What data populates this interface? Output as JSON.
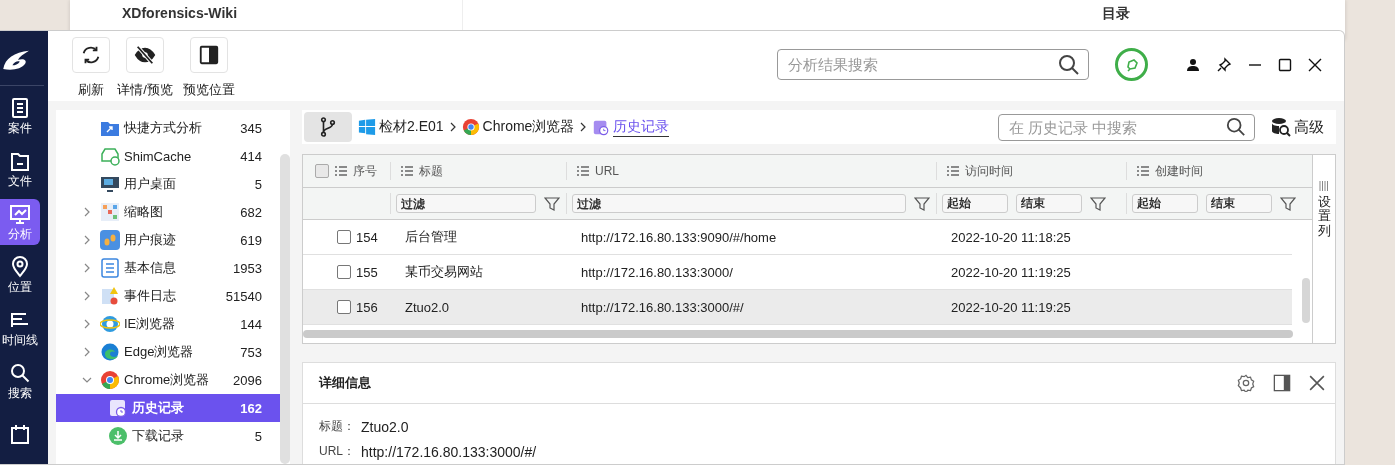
{
  "background_window": {
    "site_title": "XDforensics-Wiki",
    "toc_title": "目录"
  },
  "nav_rail": {
    "items": [
      {
        "label": "案件",
        "kind": "case",
        "selected": false
      },
      {
        "label": "文件",
        "kind": "file",
        "selected": false
      },
      {
        "label": "分析",
        "kind": "analysis",
        "selected": true
      },
      {
        "label": "位置",
        "kind": "location",
        "selected": false
      },
      {
        "label": "时间线",
        "kind": "timeline",
        "selected": false
      },
      {
        "label": "搜索",
        "kind": "search",
        "selected": false
      },
      {
        "kind": "calendar",
        "selected": false
      }
    ]
  },
  "toolbar": {
    "buttons": [
      {
        "label": "刷新",
        "kind": "refresh"
      },
      {
        "label": "详情/预览",
        "kind": "hide"
      },
      {
        "label": "预览位置",
        "kind": "panel"
      }
    ],
    "search": {
      "placeholder": "分析结果搜索"
    }
  },
  "tree": {
    "items": [
      {
        "label": "快捷方式分析",
        "count": "345",
        "kind": "shortcut",
        "selected": false
      },
      {
        "label": "ShimCache",
        "count": "414",
        "kind": "shimcache",
        "selected": false
      },
      {
        "label": "用户桌面",
        "count": "5",
        "kind": "desktop",
        "selected": false
      },
      {
        "label": "缩略图",
        "count": "682",
        "kind": "thumbnail",
        "expanded": false,
        "selected": false
      },
      {
        "label": "用户痕迹",
        "count": "619",
        "kind": "trace",
        "expanded": false,
        "selected": false
      },
      {
        "label": "基本信息",
        "count": "1953",
        "kind": "info",
        "expanded": false,
        "selected": false
      },
      {
        "label": "事件日志",
        "count": "51540",
        "kind": "eventlog",
        "expanded": false,
        "selected": false
      },
      {
        "label": "IE浏览器",
        "count": "144",
        "kind": "ie",
        "expanded": false,
        "selected": false
      },
      {
        "label": "Edge浏览器",
        "count": "753",
        "kind": "edge",
        "expanded": false,
        "selected": false
      },
      {
        "label": "Chrome浏览器",
        "count": "2096",
        "kind": "chrome",
        "expanded": true,
        "selected": false,
        "children": [
          {
            "label": "历史记录",
            "count": "162",
            "kind": "history",
            "selected": true
          },
          {
            "label": "下载记录",
            "count": "5",
            "kind": "download",
            "selected": false
          }
        ]
      }
    ]
  },
  "breadcrumb": [
    {
      "label": "检材2.E01",
      "kind": "disk"
    },
    {
      "label": "Chrome浏览器",
      "kind": "chrome"
    },
    {
      "label": "历史记录",
      "kind": "history"
    }
  ],
  "table_search": {
    "placeholder": "在 历史记录 中搜索"
  },
  "advanced_button": "高级",
  "table": {
    "all_checked": false,
    "columns": [
      {
        "label": "序号",
        "kind": "none"
      },
      {
        "label": "标题",
        "kind": "text",
        "placeholder": "过滤"
      },
      {
        "label": "URL",
        "kind": "text",
        "placeholder": "过滤"
      },
      {
        "label": "访问时间",
        "kind": "range",
        "from": "起始",
        "to": "结束"
      },
      {
        "label": "创建时间",
        "kind": "range",
        "from": "起始",
        "to": "结束"
      }
    ],
    "rows": [
      {
        "index": "154",
        "title": "后台管理",
        "url": "http://172.16.80.133:9090/#/home",
        "visited": "2022-10-20 11:18:25",
        "checked": false,
        "selected": false
      },
      {
        "index": "155",
        "title": "某币交易网站",
        "url": "http://172.16.80.133:3000/",
        "visited": "2022-10-20 11:19:25",
        "checked": false,
        "selected": false
      },
      {
        "index": "156",
        "title": "Ztuo2.0",
        "url": "http://172.16.80.133:3000/#/",
        "visited": "2022-10-20 11:19:25",
        "checked": false,
        "selected": true
      }
    ],
    "column_settings": "设置列"
  },
  "detail": {
    "title": "详细信息",
    "fields": [
      {
        "label": "标题：",
        "value": "Ztuo2.0"
      },
      {
        "label": "URL：",
        "value": "http://172.16.80.133:3000/#/"
      }
    ]
  }
}
